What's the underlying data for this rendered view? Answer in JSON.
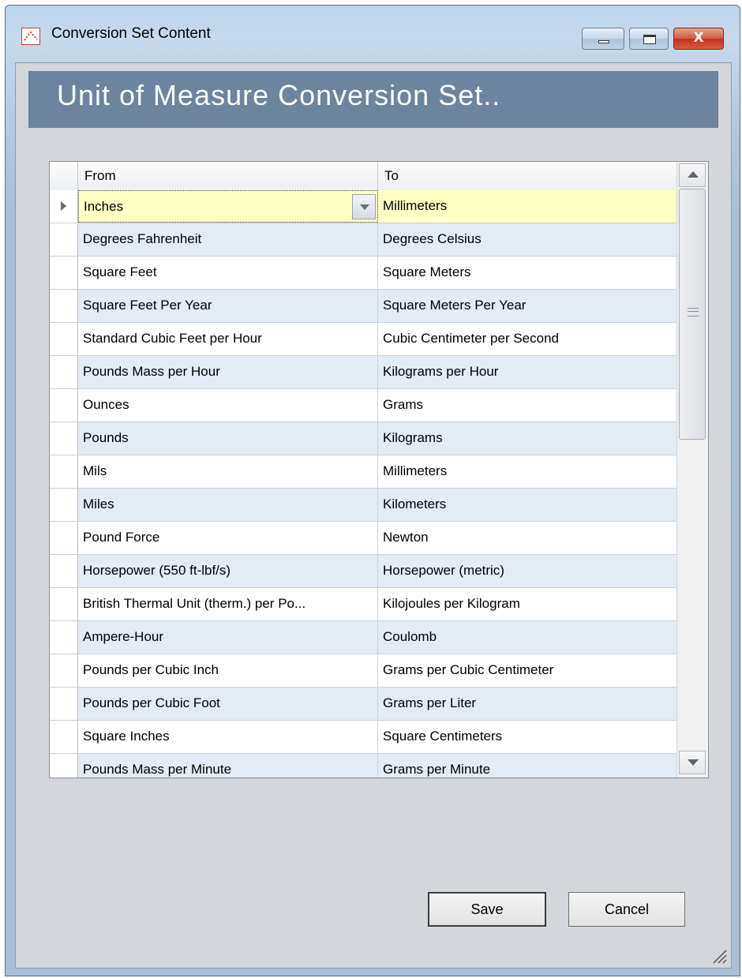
{
  "window": {
    "title": "Conversion Set Content",
    "close_glyph": "X"
  },
  "header": {
    "title": "Unit of Measure Conversion Set.."
  },
  "grid": {
    "columns": {
      "from": "From",
      "to": "To"
    },
    "rows": [
      {
        "from": "Inches",
        "to": "Millimeters"
      },
      {
        "from": "Degrees Fahrenheit",
        "to": "Degrees Celsius"
      },
      {
        "from": "Square Feet",
        "to": "Square Meters"
      },
      {
        "from": "Square Feet Per Year",
        "to": "Square Meters Per Year"
      },
      {
        "from": "Standard Cubic Feet per Hour",
        "to": "Cubic Centimeter per Second"
      },
      {
        "from": "Pounds Mass per Hour",
        "to": "Kilograms per Hour"
      },
      {
        "from": "Ounces",
        "to": "Grams"
      },
      {
        "from": "Pounds",
        "to": "Kilograms"
      },
      {
        "from": "Mils",
        "to": "Millimeters"
      },
      {
        "from": "Miles",
        "to": "Kilometers"
      },
      {
        "from": "Pound Force",
        "to": "Newton"
      },
      {
        "from": "Horsepower (550 ft-lbf/s)",
        "to": "Horsepower (metric)"
      },
      {
        "from": "British Thermal Unit (therm.) per Po...",
        "to": "Kilojoules per Kilogram"
      },
      {
        "from": "Ampere-Hour",
        "to": "Coulomb"
      },
      {
        "from": "Pounds per Cubic Inch",
        "to": "Grams per Cubic Centimeter"
      },
      {
        "from": "Pounds per Cubic Foot",
        "to": "Grams per Liter"
      },
      {
        "from": "Square Inches",
        "to": "Square Centimeters"
      },
      {
        "from": "Pounds Mass per Minute",
        "to": "Grams per Minute"
      }
    ]
  },
  "buttons": {
    "save": "Save",
    "cancel": "Cancel"
  },
  "icons": {
    "app": "conversion-app-icon",
    "minimize": "minimize-icon",
    "maximize": "maximize-icon",
    "close": "close-icon",
    "dropdown": "chevron-down-icon",
    "row_pointer": "row-pointer-icon",
    "scroll_up": "scroll-up-icon",
    "scroll_down": "scroll-down-icon",
    "resize": "resize-grip-icon"
  },
  "colors": {
    "banner": "#6c849f",
    "active_row": "#ffffc4",
    "alt_row": "#e3ebf5"
  }
}
